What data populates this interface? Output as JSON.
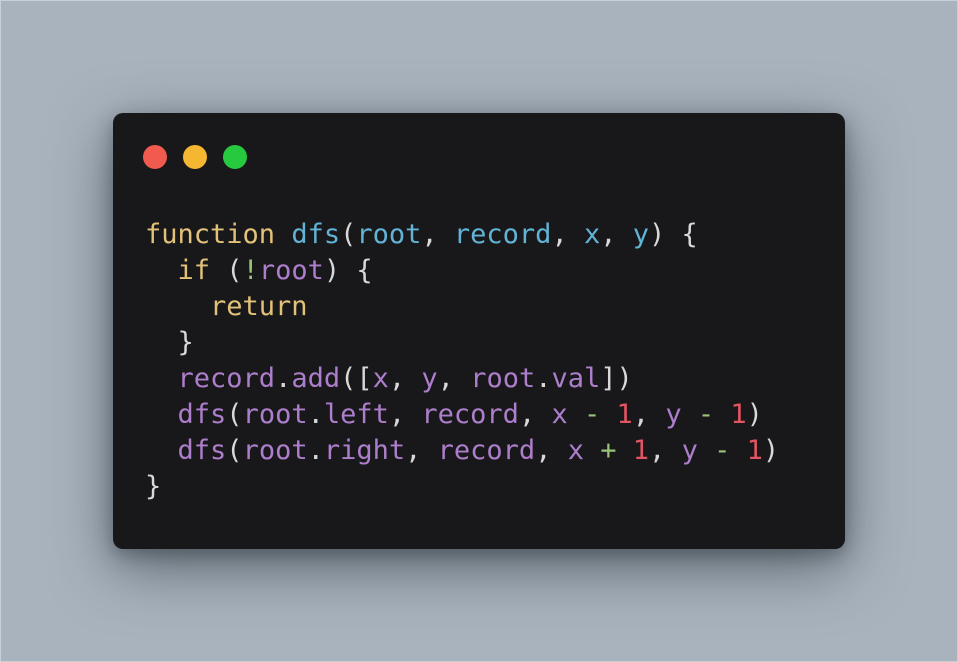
{
  "window": {
    "controls": {
      "close_color": "#f05a4f",
      "minimize_color": "#f5b731",
      "maximize_color": "#27c93f"
    }
  },
  "code": {
    "language": "javascript",
    "lines": [
      [
        {
          "t": "function",
          "c": "kw"
        },
        {
          "t": " ",
          "c": "punc"
        },
        {
          "t": "dfs",
          "c": "fn"
        },
        {
          "t": "(",
          "c": "punc"
        },
        {
          "t": "root",
          "c": "param"
        },
        {
          "t": ", ",
          "c": "punc"
        },
        {
          "t": "record",
          "c": "param"
        },
        {
          "t": ", ",
          "c": "punc"
        },
        {
          "t": "x",
          "c": "param"
        },
        {
          "t": ", ",
          "c": "punc"
        },
        {
          "t": "y",
          "c": "param"
        },
        {
          "t": ") {",
          "c": "punc"
        }
      ],
      [
        {
          "t": "  ",
          "c": "punc"
        },
        {
          "t": "if",
          "c": "kw"
        },
        {
          "t": " (",
          "c": "punc"
        },
        {
          "t": "!",
          "c": "op"
        },
        {
          "t": "root",
          "c": "var"
        },
        {
          "t": ") {",
          "c": "punc"
        }
      ],
      [
        {
          "t": "    ",
          "c": "punc"
        },
        {
          "t": "return",
          "c": "kw"
        }
      ],
      [
        {
          "t": "  }",
          "c": "punc"
        }
      ],
      [
        {
          "t": "  ",
          "c": "punc"
        },
        {
          "t": "record",
          "c": "var"
        },
        {
          "t": ".",
          "c": "punc"
        },
        {
          "t": "add",
          "c": "var"
        },
        {
          "t": "([",
          "c": "punc"
        },
        {
          "t": "x",
          "c": "var"
        },
        {
          "t": ", ",
          "c": "punc"
        },
        {
          "t": "y",
          "c": "var"
        },
        {
          "t": ", ",
          "c": "punc"
        },
        {
          "t": "root",
          "c": "var"
        },
        {
          "t": ".",
          "c": "punc"
        },
        {
          "t": "val",
          "c": "var"
        },
        {
          "t": "])",
          "c": "punc"
        }
      ],
      [
        {
          "t": "  ",
          "c": "punc"
        },
        {
          "t": "dfs",
          "c": "var"
        },
        {
          "t": "(",
          "c": "punc"
        },
        {
          "t": "root",
          "c": "var"
        },
        {
          "t": ".",
          "c": "punc"
        },
        {
          "t": "left",
          "c": "var"
        },
        {
          "t": ", ",
          "c": "punc"
        },
        {
          "t": "record",
          "c": "var"
        },
        {
          "t": ", ",
          "c": "punc"
        },
        {
          "t": "x",
          "c": "var"
        },
        {
          "t": " ",
          "c": "punc"
        },
        {
          "t": "-",
          "c": "op"
        },
        {
          "t": " ",
          "c": "punc"
        },
        {
          "t": "1",
          "c": "num"
        },
        {
          "t": ", ",
          "c": "punc"
        },
        {
          "t": "y",
          "c": "var"
        },
        {
          "t": " ",
          "c": "punc"
        },
        {
          "t": "-",
          "c": "op"
        },
        {
          "t": " ",
          "c": "punc"
        },
        {
          "t": "1",
          "c": "num"
        },
        {
          "t": ")",
          "c": "punc"
        }
      ],
      [
        {
          "t": "  ",
          "c": "punc"
        },
        {
          "t": "dfs",
          "c": "var"
        },
        {
          "t": "(",
          "c": "punc"
        },
        {
          "t": "root",
          "c": "var"
        },
        {
          "t": ".",
          "c": "punc"
        },
        {
          "t": "right",
          "c": "var"
        },
        {
          "t": ", ",
          "c": "punc"
        },
        {
          "t": "record",
          "c": "var"
        },
        {
          "t": ", ",
          "c": "punc"
        },
        {
          "t": "x",
          "c": "var"
        },
        {
          "t": " ",
          "c": "punc"
        },
        {
          "t": "+",
          "c": "op"
        },
        {
          "t": " ",
          "c": "punc"
        },
        {
          "t": "1",
          "c": "num"
        },
        {
          "t": ", ",
          "c": "punc"
        },
        {
          "t": "y",
          "c": "var"
        },
        {
          "t": " ",
          "c": "punc"
        },
        {
          "t": "-",
          "c": "op"
        },
        {
          "t": " ",
          "c": "punc"
        },
        {
          "t": "1",
          "c": "num"
        },
        {
          "t": ")",
          "c": "punc"
        }
      ],
      [
        {
          "t": "}",
          "c": "punc"
        }
      ]
    ]
  }
}
